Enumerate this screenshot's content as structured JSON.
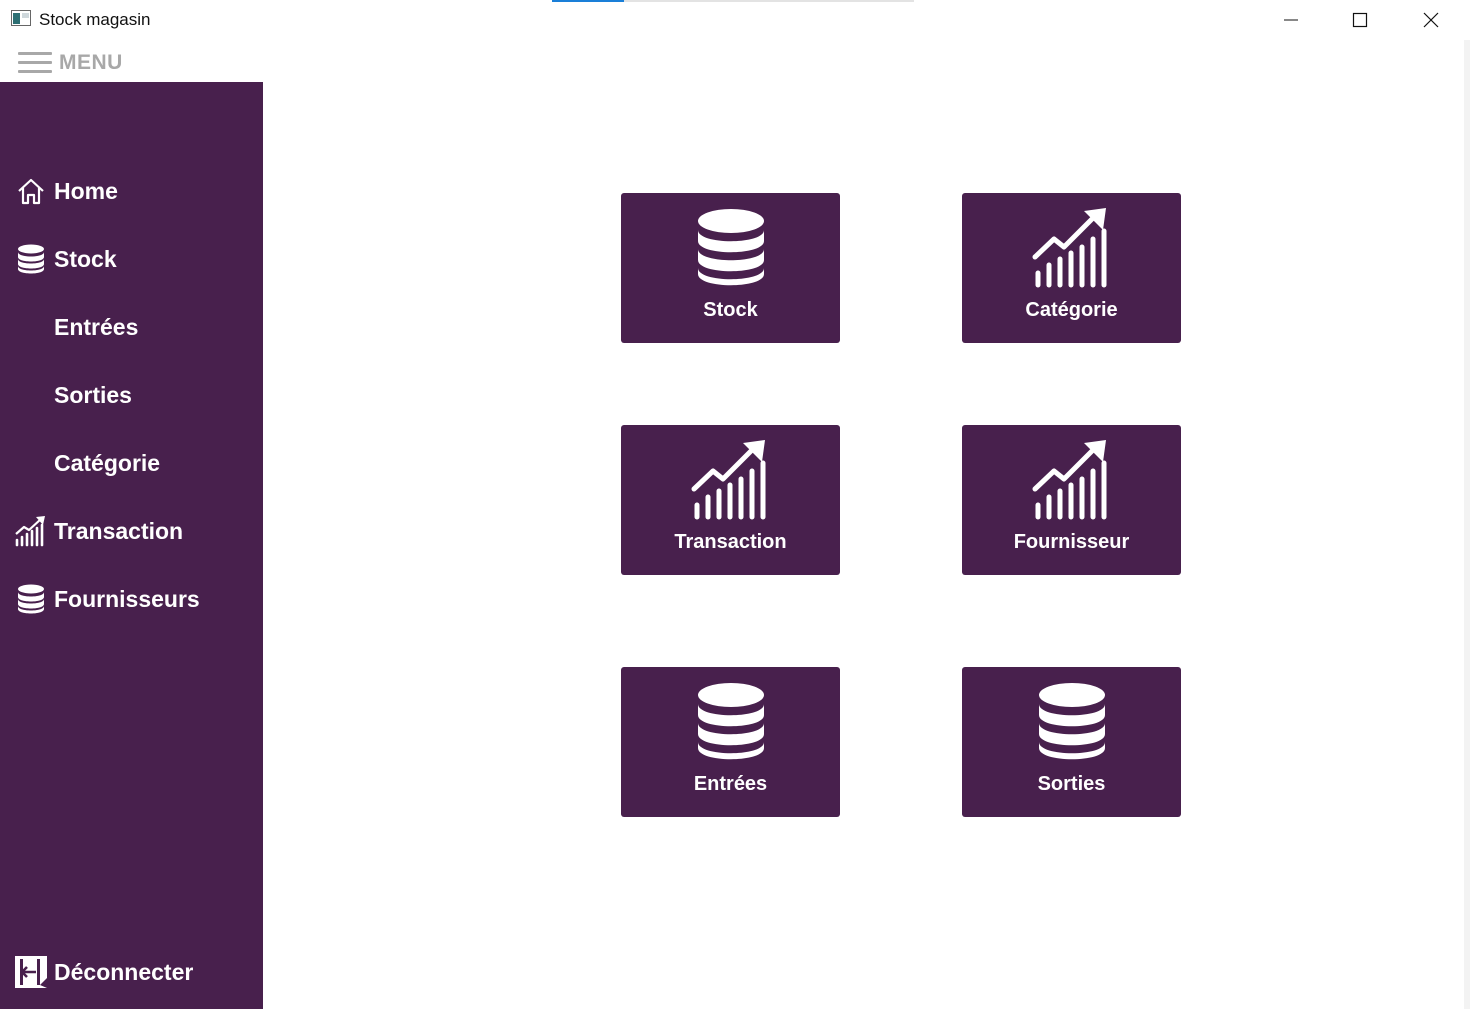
{
  "window": {
    "title": "Stock magasin",
    "loading_progress": 0.2
  },
  "menu_toggle": {
    "label": "MENU"
  },
  "sidebar": {
    "items": [
      {
        "label": "Home",
        "icon": "home-icon"
      },
      {
        "label": "Stock",
        "icon": "database-icon"
      },
      {
        "label": "Entrées",
        "icon": ""
      },
      {
        "label": "Sorties",
        "icon": ""
      },
      {
        "label": "Catégorie",
        "icon": ""
      },
      {
        "label": "Transaction",
        "icon": "chart-growth-icon"
      },
      {
        "label": "Fournisseurs",
        "icon": "database-icon"
      }
    ],
    "logout": {
      "label": "Déconnecter",
      "icon": "logout-icon"
    }
  },
  "tiles": [
    {
      "label": "Stock",
      "icon": "database-icon"
    },
    {
      "label": "Catégorie",
      "icon": "chart-growth-icon"
    },
    {
      "label": "Transaction",
      "icon": "chart-growth-icon"
    },
    {
      "label": "Fournisseur",
      "icon": "chart-growth-icon"
    },
    {
      "label": "Entrées",
      "icon": "database-icon"
    },
    {
      "label": "Sorties",
      "icon": "database-icon"
    }
  ],
  "colors": {
    "sidebar_bg": "#48204d",
    "tile_bg": "#48204d",
    "text_light": "#ffffff",
    "menu_gray": "#a8a8a8",
    "progress_accent": "#1a7fd8"
  }
}
